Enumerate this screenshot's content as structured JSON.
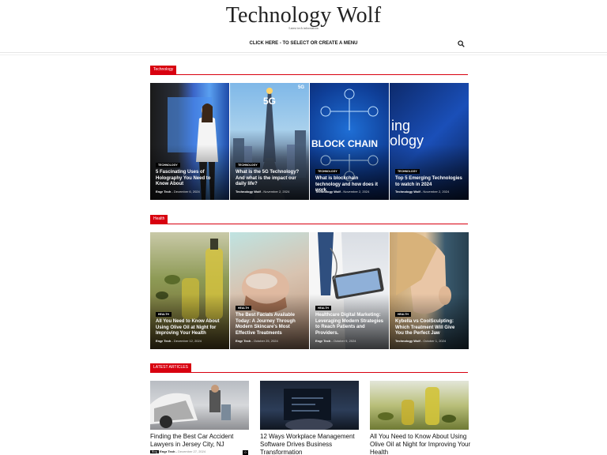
{
  "site": {
    "title": "Technology Wolf",
    "tagline": "Latest tech information",
    "menu_label": "CLICK HERE - TO SELECT OR CREATE A MENU"
  },
  "colors": {
    "accent": "#d8000f",
    "text": "#111111"
  },
  "sections": [
    {
      "label": "Technology",
      "tiles": [
        {
          "category": "TECHNOLOGY",
          "title": "5 Fascinating Uses of Holography You Need to Know About",
          "author": "Engr Tech",
          "date": "December 6, 2024"
        },
        {
          "category": "TECHNOLOGY",
          "title": "What is the 5G Technology? And what is the impact our daily life?",
          "author": "Technology Wolf",
          "date": "November 2, 2024"
        },
        {
          "category": "TECHNOLOGY",
          "title": "What is blockchain technology and how does it work",
          "author": "Technology Wolf",
          "date": "November 2, 2024"
        },
        {
          "category": "TECHNOLOGY",
          "title": "Top 5 Emerging Technologies to watch in 2024",
          "author": "Technology Wolf",
          "date": "November 2, 2024"
        }
      ]
    },
    {
      "label": "Health",
      "tiles": [
        {
          "category": "HEALTH",
          "title": "All You Need to Know About Using Olive Oil at Night for Improving Your Health",
          "author": "Engr Tech",
          "date": "December 12, 2024"
        },
        {
          "category": "HEALTH",
          "title": "The Best Facials Available Today: A Journey Through Modern Skincare's Most Effective Treatments",
          "author": "Engr Tech",
          "date": "October 25, 2024"
        },
        {
          "category": "HEALTH",
          "title": "Healthcare Digital Marketing: Leveraging Modern Strategies to Reach Patients and Providers.",
          "author": "Engr Tech",
          "date": "October 9, 2024"
        },
        {
          "category": "HEALTH",
          "title": "Kybella vs CoolSculpting: Which Treatment Will Give You the Perfect Jaw",
          "author": "Technology Wolf",
          "date": "October 1, 2024"
        }
      ]
    }
  ],
  "latest": {
    "label": "LATEST ARTICLES",
    "cards": [
      {
        "title": "Finding the Best Car Accident Lawyers in Jersey City, NJ",
        "badge": "Blog",
        "author": "Engr Tech",
        "date": "December 27, 2024",
        "comments": "0"
      },
      {
        "title": "12 Ways Workplace Management Software Drives Business Transformation",
        "badge": "",
        "author": "",
        "date": ""
      },
      {
        "title": "All You Need to Know About Using Olive Oil at Night for Improving Your Health",
        "badge": "",
        "author": "",
        "date": ""
      }
    ]
  },
  "tile_art": {
    "t1_text": "",
    "t2_text": "5G",
    "t3_text": "BLOCK CHAIN",
    "t4_text_1": "ing",
    "t4_text_2": "ology"
  }
}
